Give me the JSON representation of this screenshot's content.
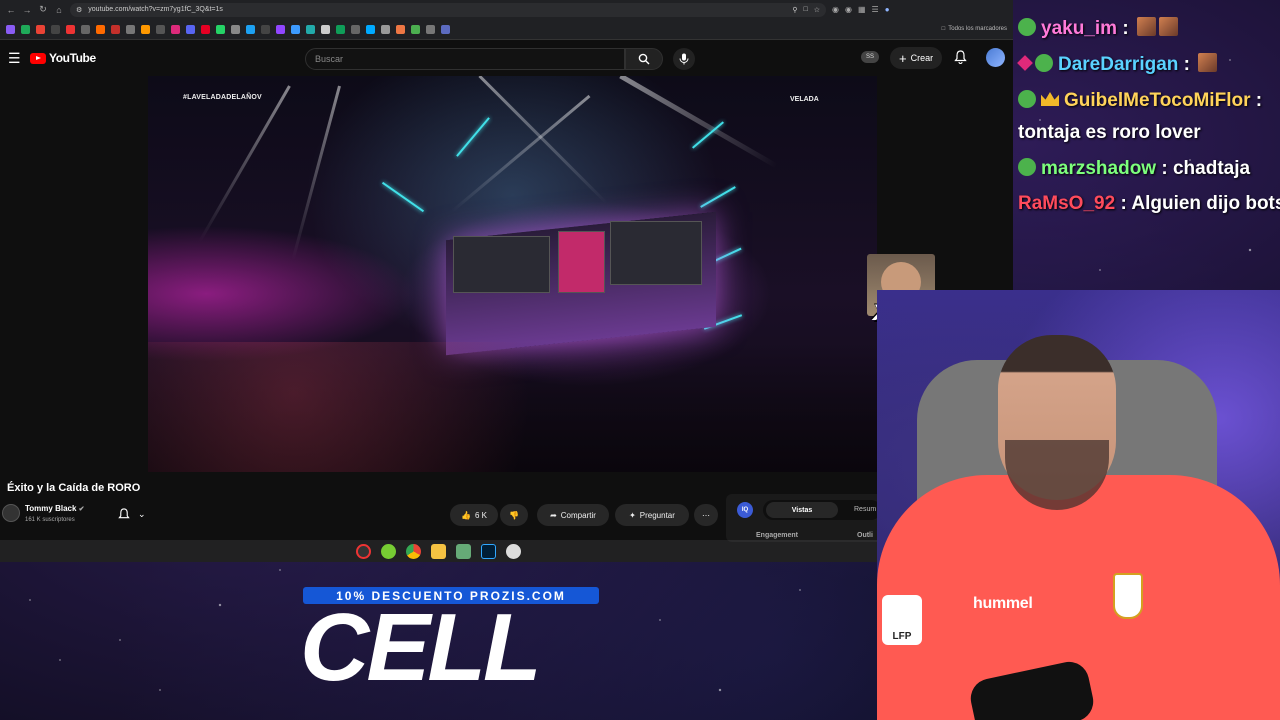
{
  "browser": {
    "url": "youtube.com/watch?v=zm7yg1fC_3Q&t=1s",
    "bookmarks_folder_label": "Todos los marcadores"
  },
  "youtube": {
    "logo_text": "YouTube",
    "search_placeholder": "Buscar",
    "ss_badge": "SS",
    "create_label": "Crear"
  },
  "video": {
    "hashtag": "#LAVELADADELAÑOV",
    "event_logo": "VELADA",
    "title": "Éxito y la Caída de RORO",
    "channel_name": "Tommy Black",
    "channel_subs": "161 K suscriptores",
    "like_count": "6 K",
    "share_label": "Compartir",
    "ask_label": "Preguntar"
  },
  "side_panel": {
    "badge": "IQ",
    "tab_active": "Vistas",
    "tab_other": "Resum",
    "engagement_label": "Engagement",
    "outlier_label": "Outli"
  },
  "overlay": {
    "emote_count": "x73"
  },
  "chat": [
    {
      "user": "yaku_im",
      "message": "",
      "color": "#ff7ad9",
      "badges": [
        "circle"
      ],
      "emotes": 2
    },
    {
      "user": "DareDarrigan",
      "message": "",
      "color": "#5ad2ff",
      "badges": [
        "cube",
        "circle"
      ],
      "emotes": 1
    },
    {
      "user": "GuibelMeTocoMiFlor",
      "message": "tontaja es roro lover",
      "color": "#ffd35a",
      "badges": [
        "circle",
        "crown"
      ],
      "emotes": 0
    },
    {
      "user": "marzshadow",
      "message": "chadtaja",
      "color": "#7dff7d",
      "badges": [
        "circle"
      ],
      "emotes": 0
    },
    {
      "user": "RaMsO_92",
      "message": "Alguien dijo bots?",
      "color": "#ff4b5c",
      "badges": [],
      "emotes": 0
    }
  ],
  "webcam": {
    "shirt_brand": "hummel",
    "sleeve_patch": "LFP"
  },
  "promo": {
    "discount_text": "10% DESCUENTO PROZIS.COM",
    "code": "CELL"
  },
  "colors": {
    "youtube_red": "#ff0000",
    "promo_blue": "#1557d6",
    "shirt": "#ff5a52"
  }
}
